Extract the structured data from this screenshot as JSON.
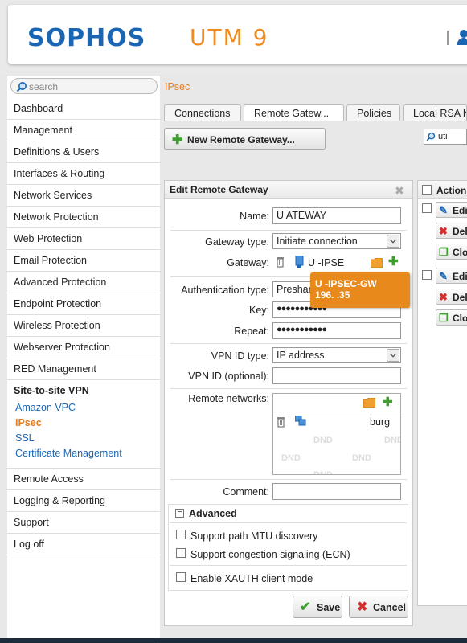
{
  "header": {
    "logo": "SOPHOS",
    "product": "UTM 9"
  },
  "search": {
    "placeholder": "search"
  },
  "breadcrumb": "IPsec",
  "sidebar": {
    "items": [
      "Dashboard",
      "Management",
      "Definitions & Users",
      "Interfaces & Routing",
      "Network Services",
      "Network Protection",
      "Web Protection",
      "Email Protection",
      "Advanced Protection",
      "Endpoint Protection",
      "Wireless Protection",
      "Webserver Protection",
      "RED Management"
    ],
    "group": {
      "title": "Site-to-site VPN",
      "subitems": [
        "Amazon VPC",
        "IPsec",
        "SSL",
        "Certificate Management"
      ],
      "active": "IPsec"
    },
    "items_after": [
      "Remote Access",
      "Logging & Reporting",
      "Support",
      "Log off"
    ]
  },
  "tabs": [
    "Connections",
    "Remote Gatew...",
    "Policies",
    "Local RSA K"
  ],
  "active_tab": "Remote Gatew...",
  "toolbar": {
    "new_label": "New Remote Gateway...",
    "filter_value": "uti"
  },
  "panel": {
    "title": "Edit Remote Gateway",
    "name_label": "Name:",
    "name_value": "U       ATEWAY",
    "gateway_type_label": "Gateway type:",
    "gateway_type_value": "Initiate connection",
    "gateway_label": "Gateway:",
    "gateway_value": "U         -IPSE",
    "auth_type_label": "Authentication type:",
    "auth_type_value": "Preshar",
    "key_label": "Key:",
    "key_value": "●●●●●●●●●●●",
    "repeat_label": "Repeat:",
    "repeat_value": "●●●●●●●●●●●",
    "vpn_id_type_label": "VPN ID type:",
    "vpn_id_type_value": "IP address",
    "vpn_id_label": "VPN ID (optional):",
    "vpn_id_value": "",
    "remote_networks_label": "Remote networks:",
    "remote_network_item": "burg",
    "dnd": "DND",
    "comment_label": "Comment:",
    "comment_value": "",
    "advanced_title": "Advanced",
    "adv_options": [
      "Support path MTU discovery",
      "Support congestion signaling (ECN)"
    ],
    "xauth_label": "Enable XAUTH client mode",
    "save_label": "Save",
    "cancel_label": "Cancel"
  },
  "tooltip": {
    "line1": "U        -IPSEC-GW",
    "line2": "196.      .35"
  },
  "right_panel": {
    "header": "Action",
    "buttons": [
      "Edit",
      "Delete",
      "Clone",
      "Edit",
      "Delete",
      "Clone"
    ]
  },
  "colors": {
    "brand": "#1b66b2",
    "accent": "#f08a1c",
    "active_nav": "#e67e22",
    "add_green": "#3e9e2e",
    "delete_red": "#d32f2f"
  }
}
